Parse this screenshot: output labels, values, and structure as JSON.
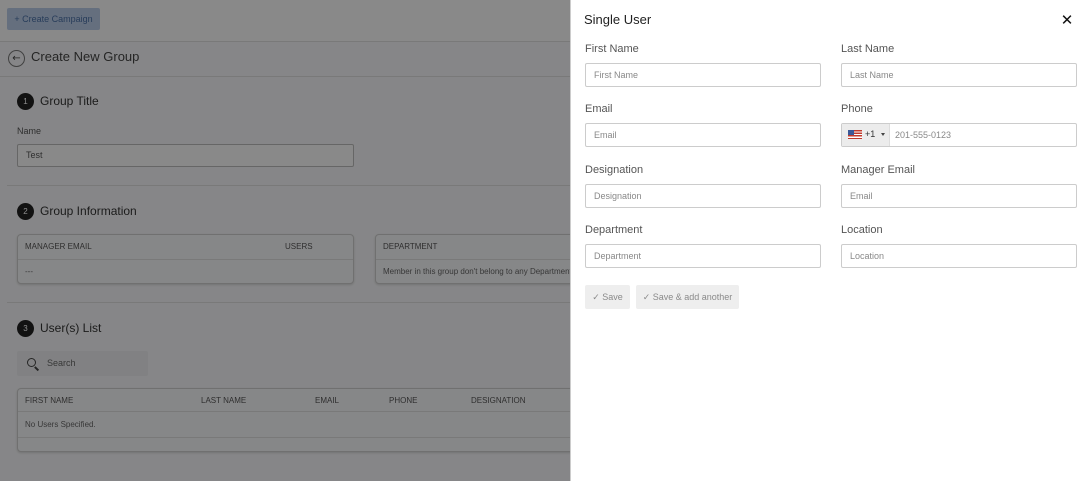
{
  "background": {
    "create_campaign_label": "+ Create Campaign",
    "back_icon": "arrow-left-icon",
    "page_title": "Create New Group",
    "sections": [
      {
        "number": "1",
        "title": "Group Title"
      },
      {
        "number": "2",
        "title": "Group Information"
      },
      {
        "number": "3",
        "title": "User(s) List"
      }
    ],
    "name_label": "Name",
    "name_value": "Test",
    "info_card_1": {
      "col1": "MANAGER EMAIL",
      "col2": "USERS",
      "value": "---"
    },
    "info_card_2": {
      "col1": "DEPARTMENT",
      "text": "Member in this group don't belong to any Department"
    },
    "search_placeholder": "Search",
    "users_table": {
      "columns": [
        "FIRST NAME",
        "LAST NAME",
        "EMAIL",
        "PHONE",
        "DESIGNATION"
      ],
      "empty_text": "No Users Specified."
    }
  },
  "drawer": {
    "title": "Single User",
    "close_icon": "close-icon",
    "fields": {
      "first_name": {
        "label": "First Name",
        "placeholder": "First Name"
      },
      "last_name": {
        "label": "Last Name",
        "placeholder": "Last Name"
      },
      "email": {
        "label": "Email",
        "placeholder": "Email"
      },
      "phone": {
        "label": "Phone",
        "dial_code": "+1",
        "placeholder": "201-555-0123",
        "flag_icon": "us-flag-icon"
      },
      "designation": {
        "label": "Designation",
        "placeholder": "Designation"
      },
      "manager_email": {
        "label": "Manager Email",
        "placeholder": "Email"
      },
      "department": {
        "label": "Department",
        "placeholder": "Department"
      },
      "location": {
        "label": "Location",
        "placeholder": "Location"
      }
    },
    "save_label": "✓ Save",
    "save_add_label": "✓ Save & add another"
  },
  "colors": {
    "overlay": "#000000",
    "button_bg": "#eeeeee",
    "campaign_btn": "#b9cbe6"
  }
}
